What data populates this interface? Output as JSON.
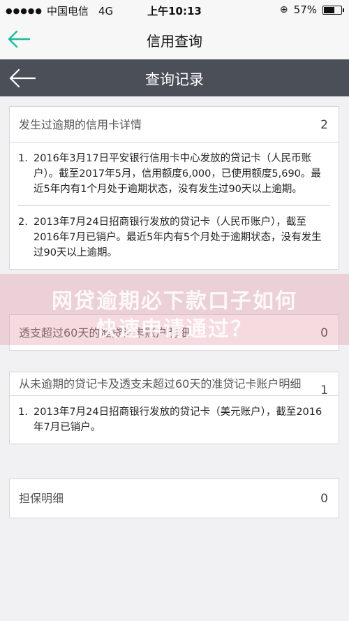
{
  "status_bar": {
    "carrier": "中国电信",
    "network": "4G",
    "time": "上午10:13",
    "battery_percent": "57%",
    "battery_level": 0.57
  },
  "nav": {
    "title": "信用查询",
    "back_icon": "arrow-left-icon",
    "accent_color": "#1abc9c"
  },
  "header": {
    "title": "查询记录",
    "back_icon": "arrow-left-icon"
  },
  "sections": [
    {
      "title": "发生过逾期的信用卡详情",
      "count": "2",
      "items": [
        {
          "num": "1.",
          "text": "2016年3月17日平安银行信用卡中心发放的贷记卡（人民币账户）。截至2017年5月，信用额度6,000，已使用额度5,690。最近5年内有1个月处于逾期状态，没有发生过90天以上逾期。"
        },
        {
          "num": "2.",
          "text": "2013年7月24日招商银行发放的贷记卡（人民币账户），截至2016年7月已销户。最近5年内有5个月处于逾期状态，没有发生过90天以上逾期。"
        }
      ]
    },
    {
      "title": "透支超过60天的准贷记卡账户明细",
      "count": "0"
    },
    {
      "title": "从未逾期的贷记卡及透支未超过60天的准贷记卡账户明细",
      "count": "1",
      "items": [
        {
          "num": "1.",
          "text": "2013年7月24日招商银行发放的贷记卡（美元账户），截至2016年7月已销户。"
        }
      ]
    },
    {
      "title": "担保明细",
      "count": "0"
    }
  ],
  "watermark": {
    "line1": "网贷逾期必下款口子如何",
    "line2": "快速申请通过？"
  }
}
